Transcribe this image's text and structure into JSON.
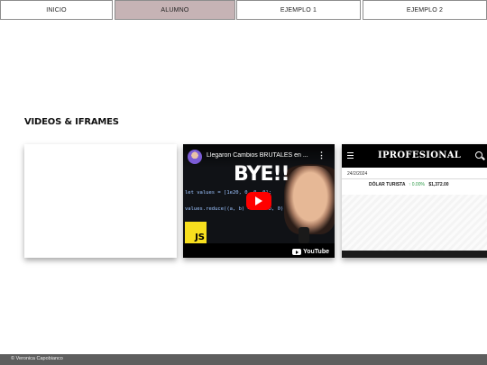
{
  "nav": {
    "items": [
      {
        "label": "INICIO",
        "active": false
      },
      {
        "label": "ALUMNO",
        "active": true
      },
      {
        "label": "EJEMPLO 1",
        "active": false
      },
      {
        "label": "EJEMPLO 2",
        "active": false
      }
    ],
    "active_color": "#c6b3b5"
  },
  "main": {
    "section_title": "VIDEOS & IFRAMES",
    "video": {
      "title": "Llegaron Cambios BRUTALES en ...",
      "overlay_text": "BYE!!",
      "code_line_1": "let values = [1e20, 0, 0, 0];",
      "code_line_2": "values.reduce((a, b) => a + b, 0);",
      "js_badge": "JS",
      "brand": "YouTube",
      "icons": [
        "channel-avatar",
        "more-vert-icon",
        "play-icon",
        "youtube-logo"
      ]
    },
    "news": {
      "logo": "IPROFESIONAL",
      "date": "24/2/2024",
      "ticker_label": "DÓLAR TURISTA",
      "ticker_change": "↑ 0.00%",
      "ticker_value": "$1,372.00",
      "icons": [
        "hamburger-menu-icon",
        "search-icon"
      ]
    }
  },
  "footer": {
    "text": "© Veronica Capobianco"
  }
}
